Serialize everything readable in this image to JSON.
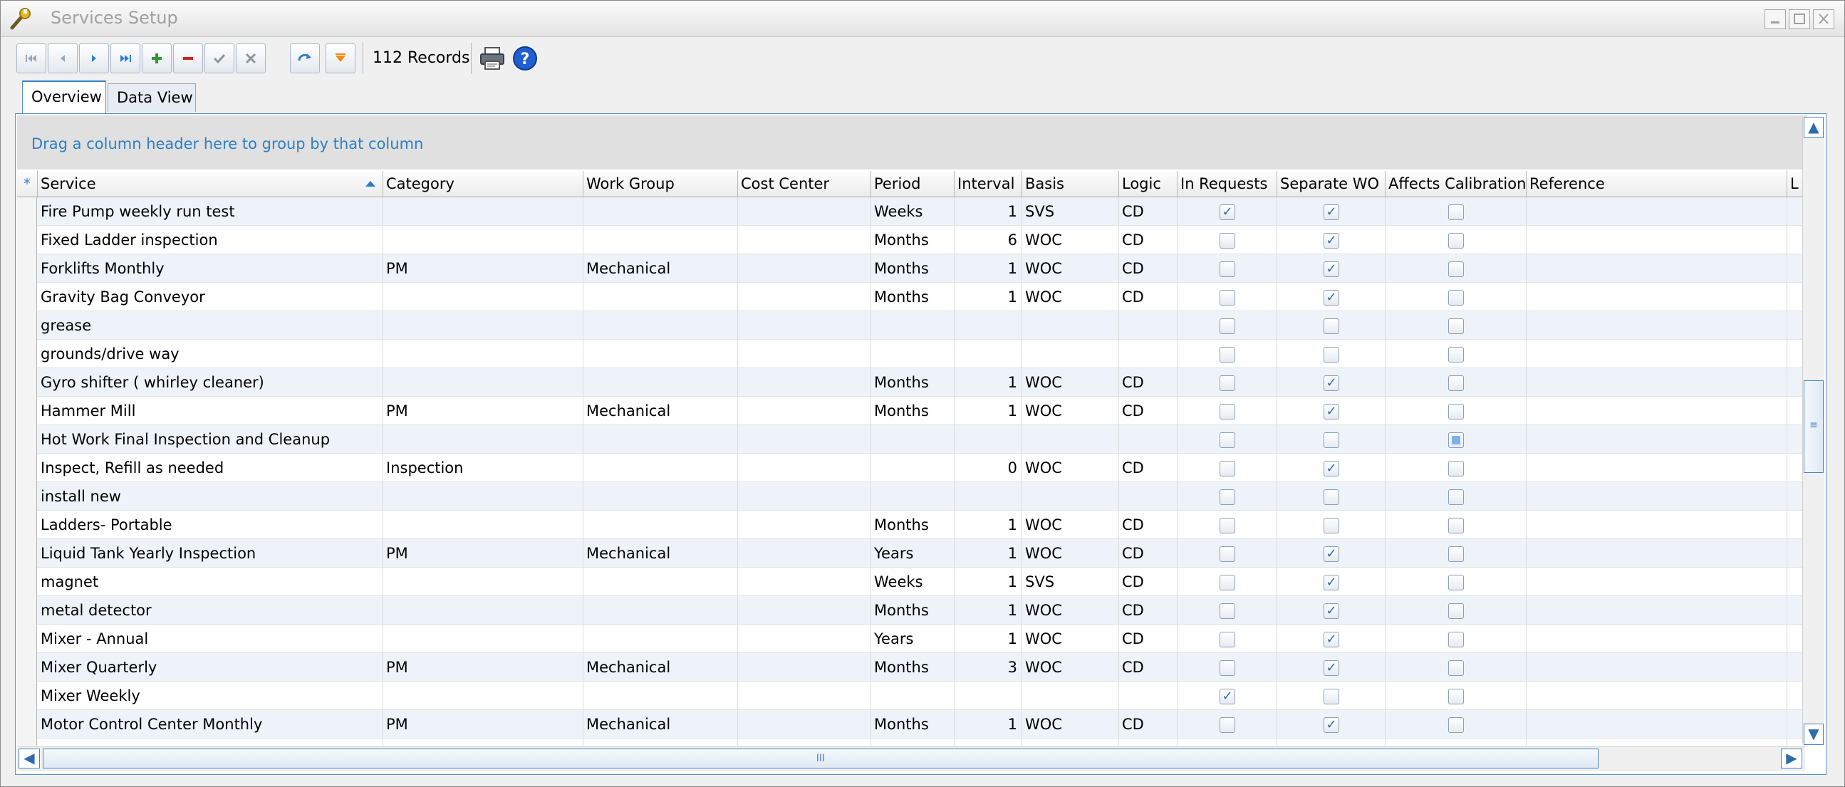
{
  "window": {
    "title": "Services Setup"
  },
  "toolbar": {
    "records_label": "112 Records",
    "buttons": [
      "first-record",
      "prev-record",
      "next-record",
      "last-record",
      "add-record",
      "delete-record",
      "post-edit",
      "cancel-edit",
      "refresh",
      "filter"
    ]
  },
  "tabs": [
    {
      "label": "Overview",
      "active": true
    },
    {
      "label": "Data View",
      "active": false
    }
  ],
  "group_hint": "Drag a column header here to group by that column",
  "columns": {
    "rowsel": "*",
    "service": "Service",
    "category": "Category",
    "work_group": "Work Group",
    "cost_center": "Cost Center",
    "period": "Period",
    "interval": "Interval",
    "basis": "Basis",
    "logic": "Logic",
    "in_requests": "In Requests",
    "separate_wo": "Separate WO",
    "affects_calibration": "Affects Calibration",
    "reference": "Reference",
    "last": "L"
  },
  "rows": [
    {
      "service": "Fire Pump weekly run test",
      "category": "",
      "work_group": "",
      "period": "Weeks",
      "interval": "1",
      "basis": "SVS",
      "logic": "CD",
      "in_requests": true,
      "separate_wo": true,
      "affects_calibration": false
    },
    {
      "service": "Fixed Ladder  inspection",
      "category": "",
      "work_group": "",
      "period": "Months",
      "interval": "6",
      "basis": "WOC",
      "logic": "CD",
      "in_requests": false,
      "separate_wo": true,
      "affects_calibration": false
    },
    {
      "service": "Forklifts Monthly",
      "category": "PM",
      "work_group": "Mechanical",
      "period": "Months",
      "interval": "1",
      "basis": "WOC",
      "logic": "CD",
      "in_requests": false,
      "separate_wo": true,
      "affects_calibration": false
    },
    {
      "service": "Gravity Bag Conveyor",
      "category": "",
      "work_group": "",
      "period": "Months",
      "interval": "1",
      "basis": "WOC",
      "logic": "CD",
      "in_requests": false,
      "separate_wo": true,
      "affects_calibration": false
    },
    {
      "service": "grease",
      "category": "",
      "work_group": "",
      "period": "",
      "interval": "",
      "basis": "",
      "logic": "",
      "in_requests": false,
      "separate_wo": false,
      "affects_calibration": false
    },
    {
      "service": "grounds/drive way",
      "category": "",
      "work_group": "",
      "period": "",
      "interval": "",
      "basis": "",
      "logic": "",
      "in_requests": false,
      "separate_wo": false,
      "affects_calibration": false
    },
    {
      "service": "Gyro shifter ( whirley cleaner)",
      "category": "",
      "work_group": "",
      "period": "Months",
      "interval": "1",
      "basis": "WOC",
      "logic": "CD",
      "in_requests": false,
      "separate_wo": true,
      "affects_calibration": false
    },
    {
      "service": "Hammer Mill",
      "category": "PM",
      "work_group": "Mechanical",
      "period": "Months",
      "interval": "1",
      "basis": "WOC",
      "logic": "CD",
      "in_requests": false,
      "separate_wo": true,
      "affects_calibration": false
    },
    {
      "service": "Hot Work Final Inspection and Cleanup",
      "category": "",
      "work_group": "",
      "period": "",
      "interval": "",
      "basis": "",
      "logic": "",
      "in_requests": false,
      "separate_wo": false,
      "affects_calibration": "indeterminate"
    },
    {
      "service": "Inspect, Refill as needed",
      "category": "Inspection",
      "work_group": "",
      "period": "",
      "interval": "0",
      "basis": "WOC",
      "logic": "CD",
      "in_requests": false,
      "separate_wo": true,
      "affects_calibration": false
    },
    {
      "service": "install new",
      "category": "",
      "work_group": "",
      "period": "",
      "interval": "",
      "basis": "",
      "logic": "",
      "in_requests": false,
      "separate_wo": false,
      "affects_calibration": false
    },
    {
      "service": "Ladders- Portable",
      "category": "",
      "work_group": "",
      "period": "Months",
      "interval": "1",
      "basis": "WOC",
      "logic": "CD",
      "in_requests": false,
      "separate_wo": false,
      "affects_calibration": false
    },
    {
      "service": "Liquid Tank Yearly Inspection",
      "category": "PM",
      "work_group": "Mechanical",
      "period": "Years",
      "interval": "1",
      "basis": "WOC",
      "logic": "CD",
      "in_requests": false,
      "separate_wo": true,
      "affects_calibration": false
    },
    {
      "service": "magnet",
      "category": "",
      "work_group": "",
      "period": "Weeks",
      "interval": "1",
      "basis": "SVS",
      "logic": "CD",
      "in_requests": false,
      "separate_wo": true,
      "affects_calibration": false
    },
    {
      "service": "metal detector",
      "category": "",
      "work_group": "",
      "period": "Months",
      "interval": "1",
      "basis": "WOC",
      "logic": "CD",
      "in_requests": false,
      "separate_wo": true,
      "affects_calibration": false
    },
    {
      "service": "Mixer - Annual",
      "category": "",
      "work_group": "",
      "period": "Years",
      "interval": "1",
      "basis": "WOC",
      "logic": "CD",
      "in_requests": false,
      "separate_wo": true,
      "affects_calibration": false
    },
    {
      "service": "Mixer Quarterly",
      "category": "PM",
      "work_group": "Mechanical",
      "period": "Months",
      "interval": "3",
      "basis": "WOC",
      "logic": "CD",
      "in_requests": false,
      "separate_wo": true,
      "affects_calibration": false
    },
    {
      "service": "Mixer Weekly",
      "category": "",
      "work_group": "",
      "period": "",
      "interval": "",
      "basis": "",
      "logic": "",
      "in_requests": true,
      "separate_wo": false,
      "affects_calibration": false
    },
    {
      "service": "Motor Control Center Monthly",
      "category": "PM",
      "work_group": "Mechanical",
      "period": "Months",
      "interval": "1",
      "basis": "WOC",
      "logic": "CD",
      "in_requests": false,
      "separate_wo": true,
      "affects_calibration": false
    },
    {
      "service": "",
      "category": "",
      "work_group": "",
      "period": "",
      "interval": "",
      "basis": "",
      "logic": "",
      "in_requests": false,
      "separate_wo": false,
      "affects_calibration": false
    }
  ],
  "scrollbars": {
    "vertical_thumb_glyph": "≡",
    "horizontal_thumb_glyph": "III",
    "up": "▲",
    "down": "▼",
    "left": "◀",
    "right": "▶"
  }
}
